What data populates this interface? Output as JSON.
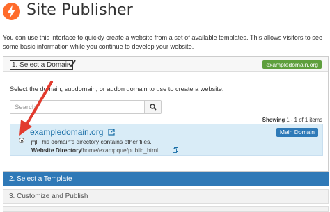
{
  "header": {
    "title": "Site Publisher",
    "logo_icon": "cpanel-bolt-icon",
    "logo_color": "#ff6c2c"
  },
  "intro": {
    "text": "You can use this interface to quickly create a website from a set of available templates. This allows visitors to see some basic information while you continue to develop your website."
  },
  "step1": {
    "label": "1. Select a Domain",
    "check_icon": "checkmark-icon",
    "selected_domain_badge": "exampledomain.org",
    "badge_color": "#5e9f3d",
    "instructions": "Select the domain, subdomain, or addon domain to use to create a website.",
    "search": {
      "placeholder": "Search",
      "value": "",
      "button_icon": "search-icon"
    },
    "showing": {
      "prefix": "Showing",
      "range": "1 - 1 of 1 items"
    },
    "domains": [
      {
        "name": "exampledomain.org",
        "badge": "Main Domain",
        "note": "This domain's directory contains other files.",
        "dir_label": "Website Directory",
        "dir_path": "/home/exampque/public_html",
        "selected": true
      }
    ]
  },
  "step2": {
    "label": "2. Select a Template",
    "color": "#2f79b7"
  },
  "step3": {
    "label": "3. Customize and Publish"
  },
  "annotation": {
    "arrow_color": "#e23b2e"
  }
}
